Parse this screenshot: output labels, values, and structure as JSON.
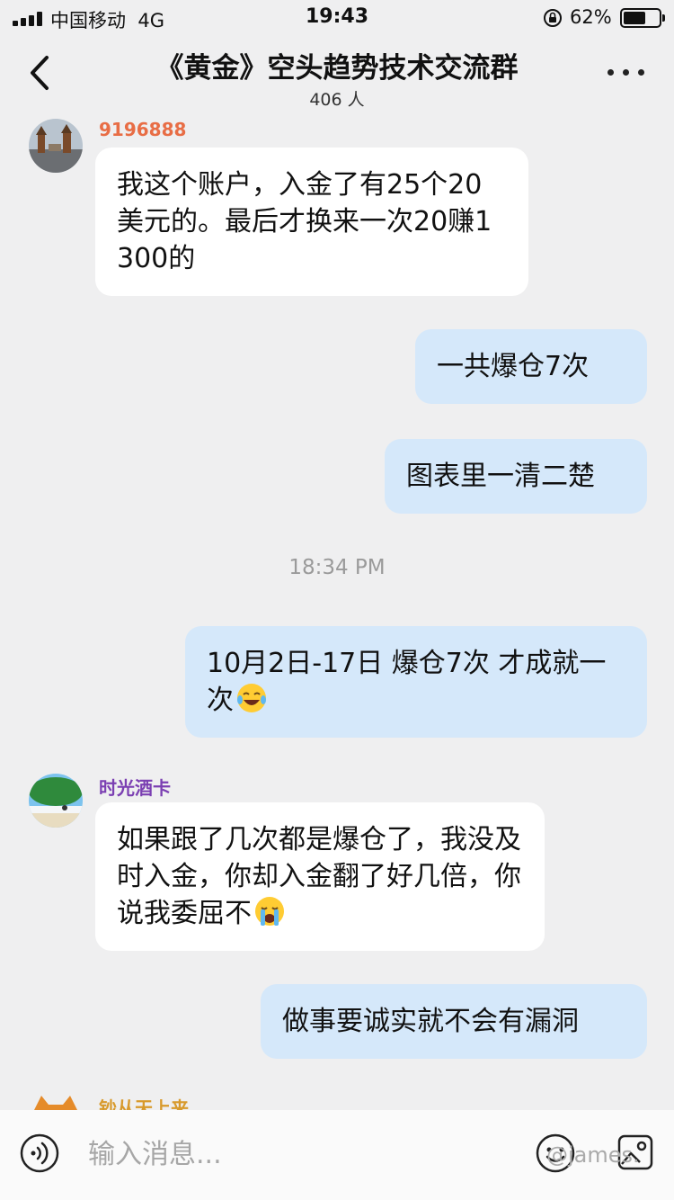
{
  "status_bar": {
    "carrier": "中国移动",
    "network": "4G",
    "time": "19:43",
    "battery_percent": "62%",
    "battery_level": 0.62
  },
  "header": {
    "title": "《黄金》空头趋势技术交流群",
    "member_count": "406 人"
  },
  "messages": [
    {
      "sender": "9196888",
      "sender_color": "#e86d45",
      "direction": "incoming",
      "text": "我这个账户，入金了有25个20美元的。最后才换来一次20赚1300的"
    },
    {
      "direction": "outgoing",
      "text": "一共爆仓7次"
    },
    {
      "direction": "outgoing",
      "text": "图表里一清二楚"
    },
    {
      "direction": "outgoing",
      "text": "10月2日-17日 爆仓7次 才成就一次",
      "emoji": "laughing-tears-emoji"
    },
    {
      "sender": "时光酒卡",
      "sender_color": "#7b3fb2",
      "direction": "incoming",
      "text": "如果跟了几次都是爆仓了，我没及时入金，你却入金翻了好几倍，你说我委屈不",
      "emoji": "crying-emoji"
    },
    {
      "direction": "outgoing",
      "text": "做事要诚实就不会有漏洞"
    },
    {
      "sender": "钞从天上来",
      "sender_color": "#d89a2c",
      "direction": "incoming",
      "text": ""
    }
  ],
  "timestamp": "18:34 PM",
  "input": {
    "placeholder": "输入消息..."
  },
  "watermark": "@james.",
  "colors": {
    "background": "#efeff0",
    "incoming_bubble": "#ffffff",
    "outgoing_bubble": "#d5e8fa"
  }
}
